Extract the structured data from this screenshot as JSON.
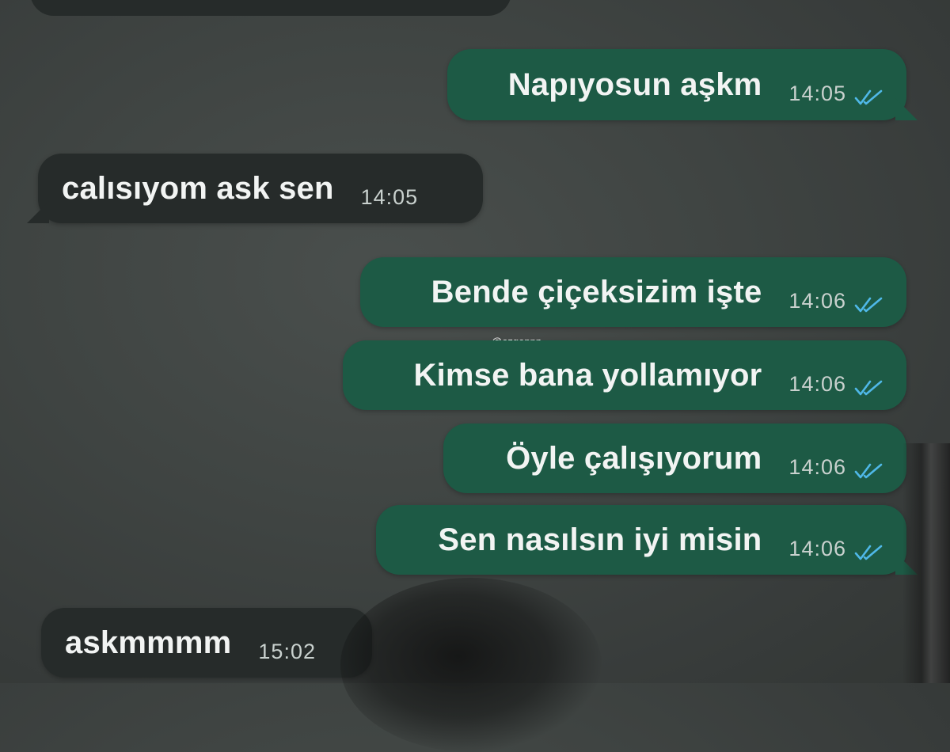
{
  "watermark": "@ozgeppn",
  "colors": {
    "incoming_bubble": "#262b2a",
    "outgoing_bubble": "#1d5a45",
    "read_tick": "#4fb8e8"
  },
  "messages": [
    {
      "direction": "outgoing",
      "text": "Napıyosun aşkm",
      "time": "14:05",
      "status_icon": "double-check-icon"
    },
    {
      "direction": "incoming",
      "text": "calısıyom ask sen",
      "time": "14:05"
    },
    {
      "direction": "outgoing",
      "text": "Bende çiçeksizim işte",
      "time": "14:06",
      "status_icon": "double-check-icon"
    },
    {
      "direction": "outgoing",
      "text": "Kimse bana yollamıyor",
      "time": "14:06",
      "status_icon": "double-check-icon"
    },
    {
      "direction": "outgoing",
      "text": "Öyle çalışıyorum",
      "time": "14:06",
      "status_icon": "double-check-icon"
    },
    {
      "direction": "outgoing",
      "text": "Sen nasılsın iyi misin",
      "time": "14:06",
      "status_icon": "double-check-icon"
    },
    {
      "direction": "incoming",
      "text": "askmmmm",
      "time": "15:02"
    }
  ]
}
